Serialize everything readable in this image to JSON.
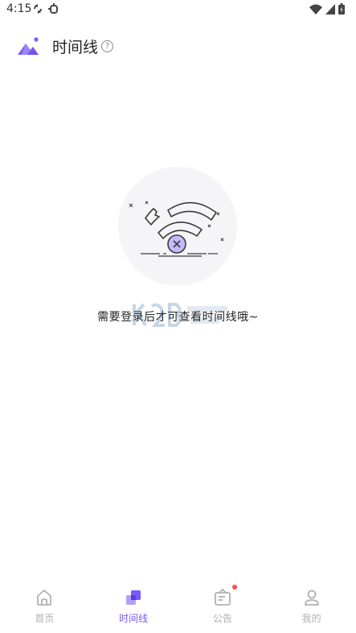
{
  "status_bar": {
    "time": "4:15",
    "left_icons": [
      "sync-icon",
      "bug-icon"
    ],
    "right_icons": [
      "wifi-icon",
      "signal-icon",
      "battery-icon"
    ]
  },
  "header": {
    "title": "时间线",
    "help_symbol": "?",
    "logo_icon": "mountain-logo-icon"
  },
  "empty_state": {
    "illustration_icon": "broken-wifi-icon",
    "message": "需要登录后才可查看时间线哦~"
  },
  "bottom_nav": {
    "items": [
      {
        "label": "首页",
        "icon": "home-icon",
        "active": false
      },
      {
        "label": "时间线",
        "icon": "timeline-icon",
        "active": true
      },
      {
        "label": "公告",
        "icon": "notice-icon",
        "active": false,
        "badge_dot": true
      },
      {
        "label": "我的",
        "icon": "profile-icon",
        "active": false
      }
    ]
  },
  "colors": {
    "accent": "#7a5af8",
    "inactive": "#b0b0b0",
    "badge": "#ff4d4f",
    "illustration_bg": "#f5f5f8"
  }
}
